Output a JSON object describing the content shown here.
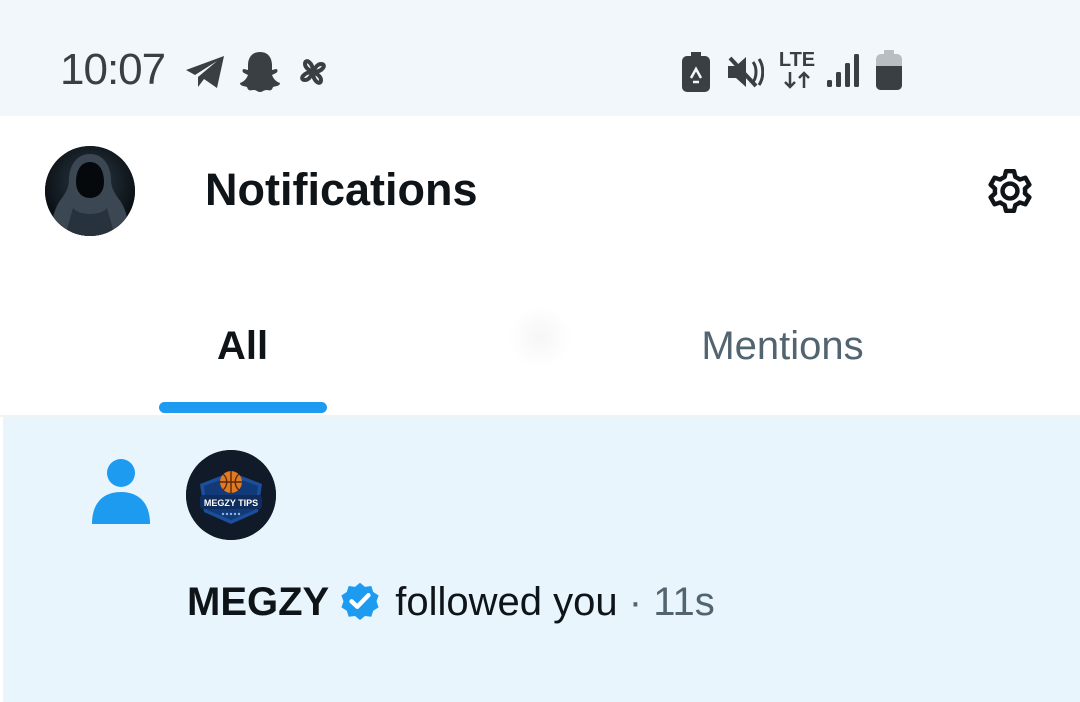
{
  "status_bar": {
    "time": "10:07",
    "left_icons": [
      "telegram-icon",
      "snapchat-icon",
      "pinwheel-icon"
    ],
    "right_icons": [
      "battery-saver-icon",
      "mute-vibrate-icon",
      "lte-icon",
      "signal-icon",
      "battery-icon"
    ],
    "network": "LTE"
  },
  "header": {
    "title": "Notifications",
    "avatar_icon": "hooded-figure-avatar",
    "settings_icon": "gear-icon"
  },
  "tabs": [
    {
      "label": "All",
      "selected": true
    },
    {
      "label": "Mentions",
      "selected": false
    }
  ],
  "notifications": [
    {
      "icon": "person-icon",
      "avatar_text": "MEGZY TIPS",
      "name": "MEGZY",
      "verified": true,
      "action": "followed you",
      "separator": "·",
      "time": "11s"
    }
  ],
  "colors": {
    "accent": "#1d9bf0",
    "status_bar_bg": "#f2f7fb",
    "unread_row_bg": "#e8f5fd",
    "secondary_text": "#536471"
  }
}
